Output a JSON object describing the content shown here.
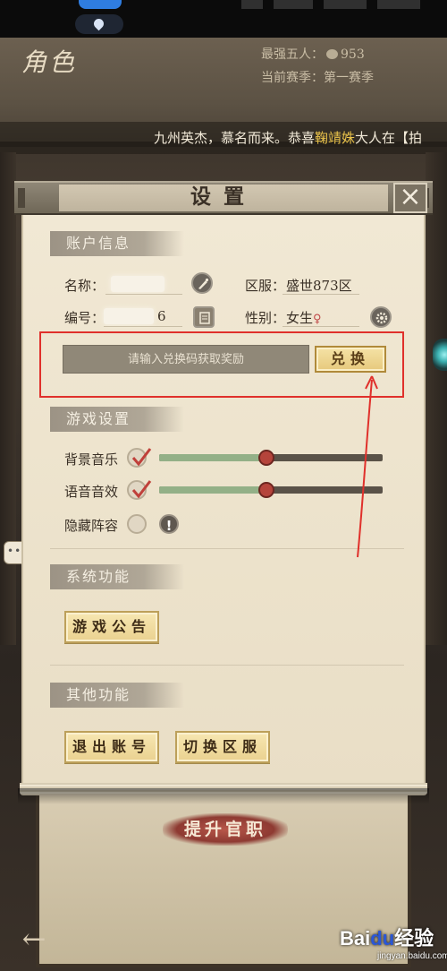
{
  "header": {
    "page_title": "角色",
    "top_five_label": "最强五人：",
    "top_five_value": "953",
    "season_label": "当前赛季：",
    "season_value": "第一赛季"
  },
  "marquee": {
    "prefix": "九州英杰，慕名而来。恭喜",
    "highlight": "鞠靖姝",
    "suffix": "大人在【拍"
  },
  "dialog": {
    "title": "设置",
    "close_label": "×",
    "account": {
      "section_label": "账户信息",
      "name_label": "名称：",
      "server_label": "区服：",
      "server_value": "盛世873区",
      "id_label": "编号：",
      "id_value": "6",
      "gender_label": "性别：",
      "gender_value": "女生",
      "gender_symbol": "♀"
    },
    "redeem": {
      "placeholder": "请输入兑换码获取奖励",
      "button_label": "兑换"
    },
    "game_settings": {
      "section_label": "游戏设置",
      "bg_music_label": "背景音乐",
      "bg_music_checked": true,
      "bg_music_level": 0.48,
      "voice_label": "语音音效",
      "voice_checked": true,
      "voice_level": 0.48,
      "hide_lineup_label": "隐藏阵容",
      "hide_lineup_checked": false,
      "info_icon": "!"
    },
    "system": {
      "section_label": "系统功能",
      "announcement_label": "游戏公告"
    },
    "other": {
      "section_label": "其他功能",
      "logout_label": "退出账号",
      "switch_server_label": "切换区服"
    }
  },
  "bottom": {
    "promote_label": "提升官职",
    "back_icon": "←"
  },
  "watermark": {
    "logo_a": "Bai",
    "logo_b": "du",
    "logo_c": "经验",
    "url": "jingyan.baidu.com"
  },
  "colors": {
    "highlight_box": "#e0302b",
    "slider_fill": "#93b087",
    "slider_knob": "#b5443b",
    "marquee_highlight": "#e9c24a"
  }
}
